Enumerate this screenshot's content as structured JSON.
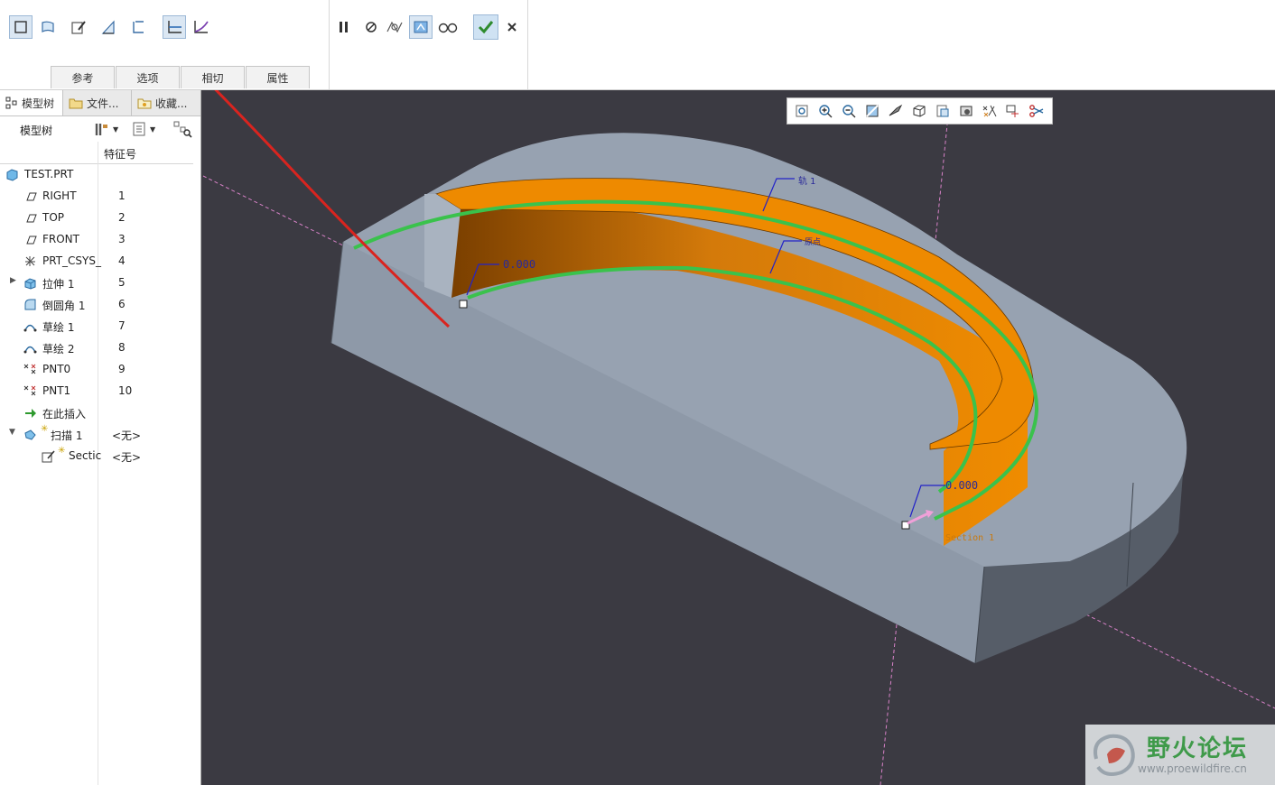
{
  "ribbon": {
    "dash_tabs": [
      "参考",
      "选项",
      "相切",
      "属性"
    ]
  },
  "panel": {
    "tabs": [
      {
        "label": "模型树"
      },
      {
        "label": "文件..."
      },
      {
        "label": "收藏..."
      }
    ],
    "toolbar_label": "模型树",
    "column_header": "特征号",
    "rows": [
      {
        "label": "TEST.PRT",
        "num": "",
        "icon": "part-icon"
      },
      {
        "label": "RIGHT",
        "num": "1",
        "icon": "datum-plane-icon"
      },
      {
        "label": "TOP",
        "num": "2",
        "icon": "datum-plane-icon"
      },
      {
        "label": "FRONT",
        "num": "3",
        "icon": "datum-plane-icon"
      },
      {
        "label": "PRT_CSYS_",
        "num": "4",
        "icon": "csys-icon"
      },
      {
        "label": "拉伸 1",
        "num": "5",
        "icon": "extrude-icon"
      },
      {
        "label": "倒圆角 1",
        "num": "6",
        "icon": "round-icon"
      },
      {
        "label": "草绘 1",
        "num": "7",
        "icon": "sketch-icon"
      },
      {
        "label": "草绘 2",
        "num": "8",
        "icon": "sketch-icon"
      },
      {
        "label": "PNT0",
        "num": "9",
        "icon": "datum-point-icon"
      },
      {
        "label": "PNT1",
        "num": "10",
        "icon": "datum-point-icon"
      },
      {
        "label": "在此插入",
        "num": "",
        "icon": "insert-here-icon"
      },
      {
        "label": "扫描 1",
        "num": "<无>",
        "icon": "sweep-icon"
      },
      {
        "label": "Sectic",
        "num": "<无>",
        "icon": "section-sketch-icon"
      }
    ]
  },
  "viewport": {
    "dim_start": "0.000",
    "dim_end": "0.000",
    "label_trajectory": "轨 1",
    "label_origin": "原点",
    "label_section": "Section 1"
  },
  "watermark": {
    "title": "野火论坛",
    "url": "www.proewildfire.cn"
  },
  "colors": {
    "viewport_bg": "#3b3a42",
    "solid_top": "#98a3b2",
    "sweep_orange": "#ee8a00",
    "trajectory_green": "#3ac24c",
    "annotation_red": "#d9241f",
    "confirm_green": "#2e8b2e"
  }
}
